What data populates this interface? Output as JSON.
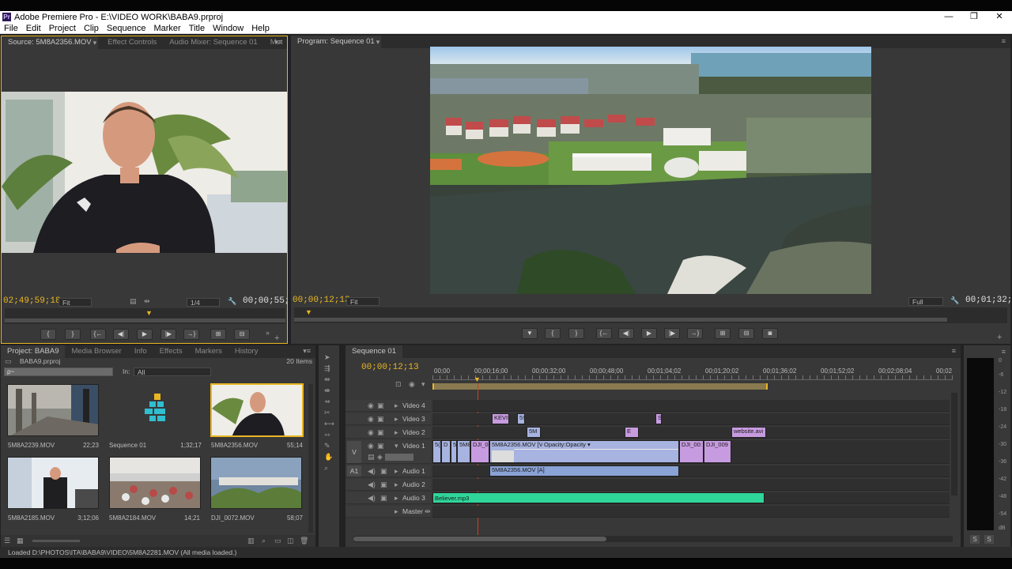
{
  "window": {
    "title": "Adobe Premiere Pro - E:\\VIDEO WORK\\BABA9.prproj",
    "app_icon": "Pr",
    "controls": [
      "—",
      "❐",
      "✕"
    ]
  },
  "menu": [
    "File",
    "Edit",
    "Project",
    "Clip",
    "Sequence",
    "Marker",
    "Title",
    "Window",
    "Help"
  ],
  "source_panel": {
    "tabs": [
      "Source: 5M8A2356.MOV",
      "Effect Controls",
      "Audio Mixer: Sequence 01",
      "Met"
    ],
    "timecode_current": "02;49;59;18",
    "fit": "Fit",
    "resolution": "1/4",
    "timecode_duration": "00;00;55;14"
  },
  "program_panel": {
    "tabs": [
      "Program: Sequence 01"
    ],
    "timecode_current": "00;00;12;13",
    "fit": "Fit",
    "resolution": "Full",
    "timecode_duration": "00;01;32;17"
  },
  "project_panel": {
    "tabs": [
      "Project: BABA9",
      "Media Browser",
      "Info",
      "Effects",
      "Markers",
      "History"
    ],
    "project_file": "BABA9.prproj",
    "items_count": "20 Items",
    "search_placeholder": "ρ~",
    "in_label": "In:",
    "in_value": "All",
    "items": [
      {
        "name": "5M8A2239.MOV",
        "duration": "22;23"
      },
      {
        "name": "Sequence 01",
        "duration": "1;32;17"
      },
      {
        "name": "5M8A2356.MOV",
        "duration": "55;14"
      },
      {
        "name": "5M8A2185.MOV",
        "duration": "3;12;06"
      },
      {
        "name": "5M8A2184.MOV",
        "duration": "14;21"
      },
      {
        "name": "DJI_0072.MOV",
        "duration": "58;07"
      }
    ]
  },
  "timeline": {
    "tab": "Sequence 01",
    "timecode": "00;00;12;13",
    "ruler": [
      "00;00",
      "00;00;16;00",
      "00;00;32;00",
      "00;00;48;00",
      "00;01;04;02",
      "00;01;20;02",
      "00;01;36;02",
      "00;01;52;02",
      "00;02;08;04",
      "00;02"
    ],
    "tracks": {
      "video4": "Video 4",
      "video3": "Video 3",
      "video2": "Video 2",
      "video1": "Video 1",
      "audio1": "Audio 1",
      "audio2": "Audio 2",
      "audio3": "Audio 3",
      "master": "Master"
    },
    "v_target": "V",
    "a_target": "A1",
    "clips": {
      "kevin": "KEVII",
      "v3b": "5!",
      "v3c": "S",
      "v2a": "5M",
      "v2b": "E",
      "website": "website.avi",
      "v1a": "5(",
      "v1b": "D",
      "v1c": "5",
      "v1d": "5M8",
      "v1e": "DJI_0",
      "v1main": "5M8A2356.MOV [V]",
      "opacity": "Opacity:Opacity ▾",
      "v1f": "DJI_00:",
      "v1g": "DJI_009",
      "a1main": "5M8A2356.MOV [A]",
      "music": "Believer.mp3"
    }
  },
  "audio_meter": {
    "scale": [
      "0",
      "-6",
      "-12",
      "-18",
      "-24",
      "-30",
      "-36",
      "-42",
      "-48",
      "-54",
      "dB"
    ],
    "solo": [
      "S",
      "S"
    ]
  },
  "status": "Loaded D:\\PHOTOS\\ITA\\BABA9\\VIDEO\\5M8A2281.MOV (All media loaded.)"
}
